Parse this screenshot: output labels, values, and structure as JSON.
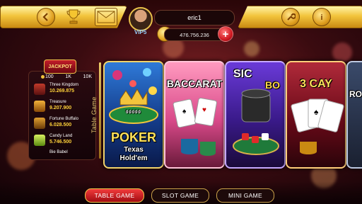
{
  "header": {
    "username": "eric1",
    "vip_label": "VIP5",
    "coin_balance": "476.756.236",
    "add_coins_label": "+",
    "left_icons": [
      "back-arrow-icon",
      "trophy-icon",
      "mail-icon"
    ],
    "right_icons": [
      "wrench-icon",
      "info-icon"
    ]
  },
  "jackpot": {
    "badge": "JACKPOT",
    "denominations": [
      "100",
      "1K",
      "10K"
    ],
    "items": [
      {
        "name": "Three Kingdom",
        "value": "10.269.875"
      },
      {
        "name": "Treasure",
        "value": "9.207.900"
      },
      {
        "name": "Fortune Buffalo",
        "value": "6.028.500"
      },
      {
        "name": "Candy Land",
        "value": "5.746.500"
      },
      {
        "name": "Bie Babel",
        "value": ""
      }
    ]
  },
  "side_label": "Table Game",
  "games": [
    {
      "title_line1": "POKER",
      "title_line2": "Texas",
      "title_line3": "Hold'em",
      "table_text": "00000"
    },
    {
      "title": "BACCARAT"
    },
    {
      "title_line1": "SIC",
      "title_line2": "BO"
    },
    {
      "title": "3 CAY"
    },
    {
      "title": "RO"
    }
  ],
  "tabs": [
    {
      "label": "TABLE GAME",
      "active": true
    },
    {
      "label": "SLOT GAME",
      "active": false
    },
    {
      "label": "MINI GAME",
      "active": false
    }
  ],
  "colors": {
    "gold": "#f2c43c",
    "red": "#c41e2a",
    "background": "#3a0b10"
  }
}
